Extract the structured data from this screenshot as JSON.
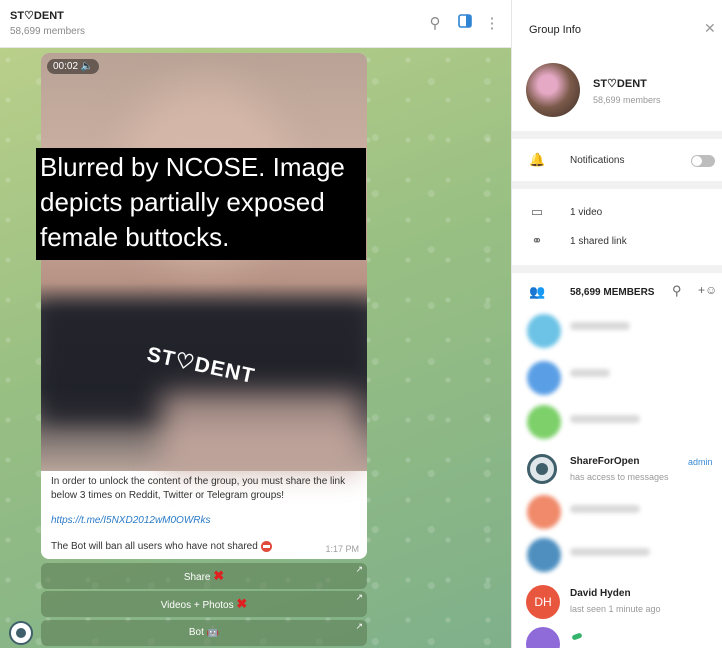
{
  "chat": {
    "title": "ST♡DENT",
    "subtitle": "58,699 members",
    "video_time": "00:02",
    "shirt_text": "ST♡DENT",
    "overlay_text": "Blurred by NCOSE. Image depicts partially exposed female buttocks.",
    "message_text": "In order to unlock the content of the group, you must share the link below 3 times on Reddit, Twitter or Telegram groups!",
    "message_link": "https://t.me/I5NXD2012wM0OWRks",
    "message_text2": "The Bot will ban all users who have not shared",
    "message_time": "1:17 PM",
    "buttons": [
      {
        "label": "Share"
      },
      {
        "label": "Videos + Photos"
      },
      {
        "label": "Bot"
      }
    ]
  },
  "info": {
    "title": "Group Info",
    "group_name": "ST♡DENT",
    "group_members": "58,699 members",
    "notifications_label": "Notifications",
    "videos_label": "1 video",
    "links_label": "1 shared link",
    "members_header": "58,699 MEMBERS",
    "members": [
      {
        "name": "ShareForOpen",
        "status": "has access to messages",
        "role": "admin"
      },
      {
        "name": "David Hyden",
        "status": "last seen 1 minute ago",
        "initials": "DH"
      }
    ]
  }
}
